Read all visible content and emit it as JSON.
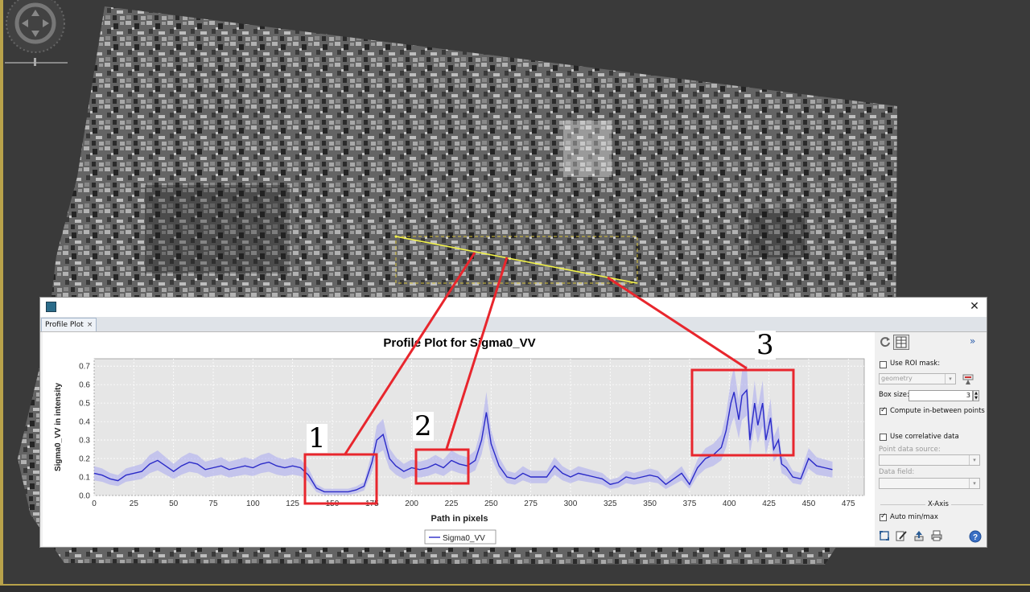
{
  "window": {
    "close_icon": "close-icon"
  },
  "tab": {
    "label": "Profile Plot",
    "close": "×"
  },
  "plot": {
    "title": "Profile Plot for Sigma0_VV",
    "legend_label": "Sigma0_VV"
  },
  "sidepanel": {
    "use_roi_mask": "Use ROI mask:",
    "roi_mask_value": "geometry",
    "box_size_label": "Box size:",
    "box_size_value": "3",
    "compute_between": "Compute in-between points",
    "use_correlative": "Use correlative data",
    "point_source_label": "Point data source:",
    "data_field_label": "Data field:",
    "x_axis_label": "X-Axis",
    "auto_minmax": "Auto min/max",
    "collapse": "»",
    "compute_between_checked": true,
    "use_roi_checked": false,
    "use_correlative_checked": false,
    "auto_minmax_checked": true
  },
  "annotations": {
    "a1": "1",
    "a2": "2",
    "a3": "3"
  },
  "colors": {
    "series": "#2a2ac8",
    "band": "#a8a8f0",
    "annotation": "#e8262d",
    "profile_line": "#f2f24a"
  },
  "chart_data": {
    "type": "line",
    "title": "Profile Plot for Sigma0_VV",
    "xlabel": "Path in pixels",
    "ylabel": "Sigma0_VV in intensity",
    "xlim": [
      0,
      485
    ],
    "ylim": [
      0,
      0.74
    ],
    "xticks": [
      0,
      25,
      50,
      75,
      100,
      125,
      150,
      175,
      200,
      225,
      250,
      275,
      300,
      325,
      350,
      375,
      400,
      425,
      450,
      475
    ],
    "yticks": [
      0.0,
      0.1,
      0.2,
      0.3,
      0.4,
      0.5,
      0.6,
      0.7
    ],
    "grid": true,
    "legend": "bottom-center",
    "series": [
      {
        "name": "Sigma0_VV",
        "x": [
          0,
          5,
          10,
          15,
          20,
          25,
          30,
          35,
          40,
          45,
          50,
          55,
          60,
          65,
          70,
          75,
          80,
          85,
          90,
          95,
          100,
          105,
          110,
          115,
          120,
          125,
          130,
          135,
          140,
          145,
          150,
          155,
          160,
          165,
          170,
          175,
          178,
          182,
          186,
          190,
          195,
          200,
          205,
          210,
          215,
          220,
          225,
          230,
          235,
          240,
          244,
          247,
          250,
          255,
          260,
          265,
          270,
          275,
          280,
          285,
          290,
          295,
          300,
          305,
          310,
          315,
          320,
          325,
          330,
          335,
          340,
          345,
          350,
          355,
          360,
          365,
          370,
          375,
          380,
          385,
          390,
          395,
          398,
          401,
          403,
          406,
          408,
          411,
          413,
          416,
          418,
          421,
          423,
          426,
          428,
          431,
          433,
          436,
          440,
          445,
          450,
          455,
          460,
          465
        ],
        "y": [
          0.12,
          0.11,
          0.09,
          0.08,
          0.11,
          0.12,
          0.13,
          0.17,
          0.19,
          0.16,
          0.13,
          0.16,
          0.18,
          0.17,
          0.14,
          0.15,
          0.16,
          0.14,
          0.15,
          0.16,
          0.15,
          0.17,
          0.18,
          0.16,
          0.15,
          0.16,
          0.15,
          0.11,
          0.04,
          0.02,
          0.02,
          0.02,
          0.02,
          0.03,
          0.05,
          0.18,
          0.3,
          0.33,
          0.2,
          0.16,
          0.13,
          0.15,
          0.14,
          0.15,
          0.17,
          0.15,
          0.19,
          0.17,
          0.16,
          0.19,
          0.3,
          0.45,
          0.28,
          0.16,
          0.1,
          0.09,
          0.12,
          0.1,
          0.1,
          0.1,
          0.16,
          0.12,
          0.1,
          0.12,
          0.11,
          0.1,
          0.09,
          0.06,
          0.07,
          0.1,
          0.09,
          0.1,
          0.11,
          0.1,
          0.06,
          0.09,
          0.12,
          0.06,
          0.15,
          0.2,
          0.22,
          0.26,
          0.35,
          0.5,
          0.56,
          0.41,
          0.54,
          0.57,
          0.3,
          0.5,
          0.38,
          0.5,
          0.3,
          0.42,
          0.25,
          0.3,
          0.17,
          0.15,
          0.1,
          0.09,
          0.2,
          0.16,
          0.15,
          0.14
        ]
      }
    ]
  }
}
